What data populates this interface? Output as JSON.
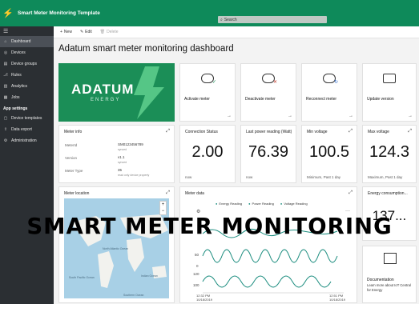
{
  "app": {
    "title": "Smart Meter Monitoring Template",
    "search_placeholder": "Search"
  },
  "sidebar": {
    "items": [
      {
        "label": "Dashboard",
        "icon": "home-icon",
        "active": true
      },
      {
        "label": "Devices",
        "icon": "devices-icon"
      },
      {
        "label": "Device groups",
        "icon": "device-groups-icon"
      },
      {
        "label": "Rules",
        "icon": "rules-icon"
      },
      {
        "label": "Analytics",
        "icon": "analytics-icon"
      },
      {
        "label": "Jobs",
        "icon": "jobs-icon"
      }
    ],
    "section": "App settings",
    "settings_items": [
      {
        "label": "Device templates",
        "icon": "templates-icon"
      },
      {
        "label": "Data export",
        "icon": "export-icon"
      },
      {
        "label": "Administration",
        "icon": "admin-icon"
      }
    ]
  },
  "toolbar": {
    "new_label": "New",
    "edit_label": "Edit",
    "delete_label": "Delete"
  },
  "page_title": "Adatum smart meter monitoring dashboard",
  "logo": {
    "name": "ADATUM",
    "sub": "ENERGY",
    "accent": "#1b8e57"
  },
  "actions": [
    {
      "label": "Activate meter",
      "icon": "meter-check-icon"
    },
    {
      "label": "Deactivate meter",
      "icon": "meter-x-icon"
    },
    {
      "label": "Reconnect meter",
      "icon": "meter-refresh-icon"
    },
    {
      "label": "Update version",
      "icon": "chip-icon"
    }
  ],
  "meter_info": {
    "title": "Meter info",
    "rows": [
      {
        "key": "MeterId",
        "value": "SM0123456789",
        "sub": "synced"
      },
      {
        "key": "Version",
        "value": "v1.1",
        "sub": "synced"
      },
      {
        "key": "Meter Type",
        "value": "35",
        "sub": "read only device property"
      }
    ]
  },
  "tiles": [
    {
      "title": "Connection Status",
      "value": "2.00",
      "sub": "now"
    },
    {
      "title": "Last power reading (Watt)",
      "value": "76.39",
      "sub": "now"
    },
    {
      "title": "Min voltage",
      "value": "100.5",
      "sub": "Minimum, Past 1 day"
    },
    {
      "title": "Max voltage",
      "value": "124.3",
      "sub": "Maximum, Past 1 day"
    }
  ],
  "meter_location": {
    "title": "Meter location",
    "labels": [
      "North Atlantic Ocean",
      "South Pacific Ocean",
      "Indian Ocean",
      "Southern Ocean"
    ]
  },
  "meter_data": {
    "title": "Meter data",
    "legend": [
      "Energy Reading",
      "Power Reading",
      "Voltage Reading"
    ],
    "yticks": [
      "50",
      "0",
      "120",
      "100"
    ],
    "x_start": "12:32 PM",
    "x_start_date": "10/18/2019",
    "x_end": "12:51 PM",
    "x_end_date": "10/18/2019"
  },
  "energy": {
    "title": "Energy consumption...",
    "value": "137..."
  },
  "documentation": {
    "title": "Documentation",
    "text": "Learn more about IoT Central for Energy"
  },
  "overlay_text": "SMART METER MONITORING",
  "colors": {
    "topbar": "#0e8a5a",
    "sidebar": "#2b2f33",
    "teal_series": "#1a8c7e"
  }
}
